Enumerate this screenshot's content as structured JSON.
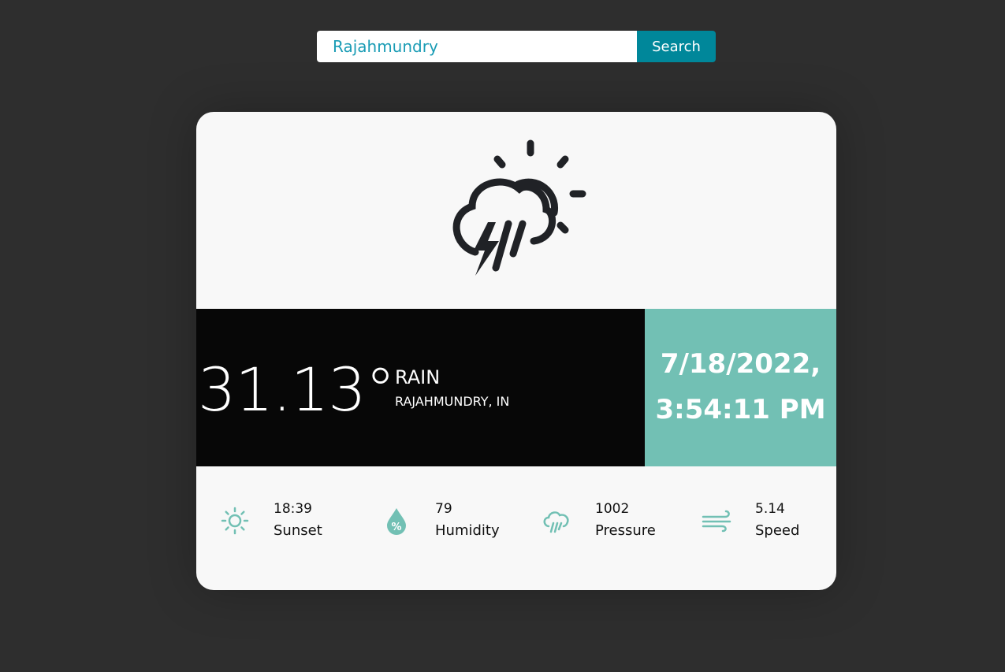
{
  "search": {
    "value": "Rajahmundry",
    "button_label": "Search"
  },
  "weather": {
    "icon": "thunderstorm-partly-sunny-icon",
    "temperature": "31.13°",
    "condition": "RAIN",
    "location": "RAJAHMUNDRY, IN",
    "date": "7/18/2022,",
    "time": "3:54:11 PM"
  },
  "stats": [
    {
      "icon": "sunset-sun-icon",
      "value": "18:39",
      "label": "Sunset"
    },
    {
      "icon": "humidity-drop-icon",
      "value": "79",
      "label": "Humidity"
    },
    {
      "icon": "rain-cloud-icon",
      "value": "1002",
      "label": "Pressure"
    },
    {
      "icon": "wind-icon",
      "value": "5.14",
      "label": "Speed"
    }
  ],
  "colors": {
    "background": "#2e2e2e",
    "card": "#f8f8f8",
    "band_dark": "#070707",
    "accent_teal": "#72c0b4",
    "button": "#00879a",
    "input_text": "#1a9cb5",
    "icon_dark": "#202226"
  }
}
